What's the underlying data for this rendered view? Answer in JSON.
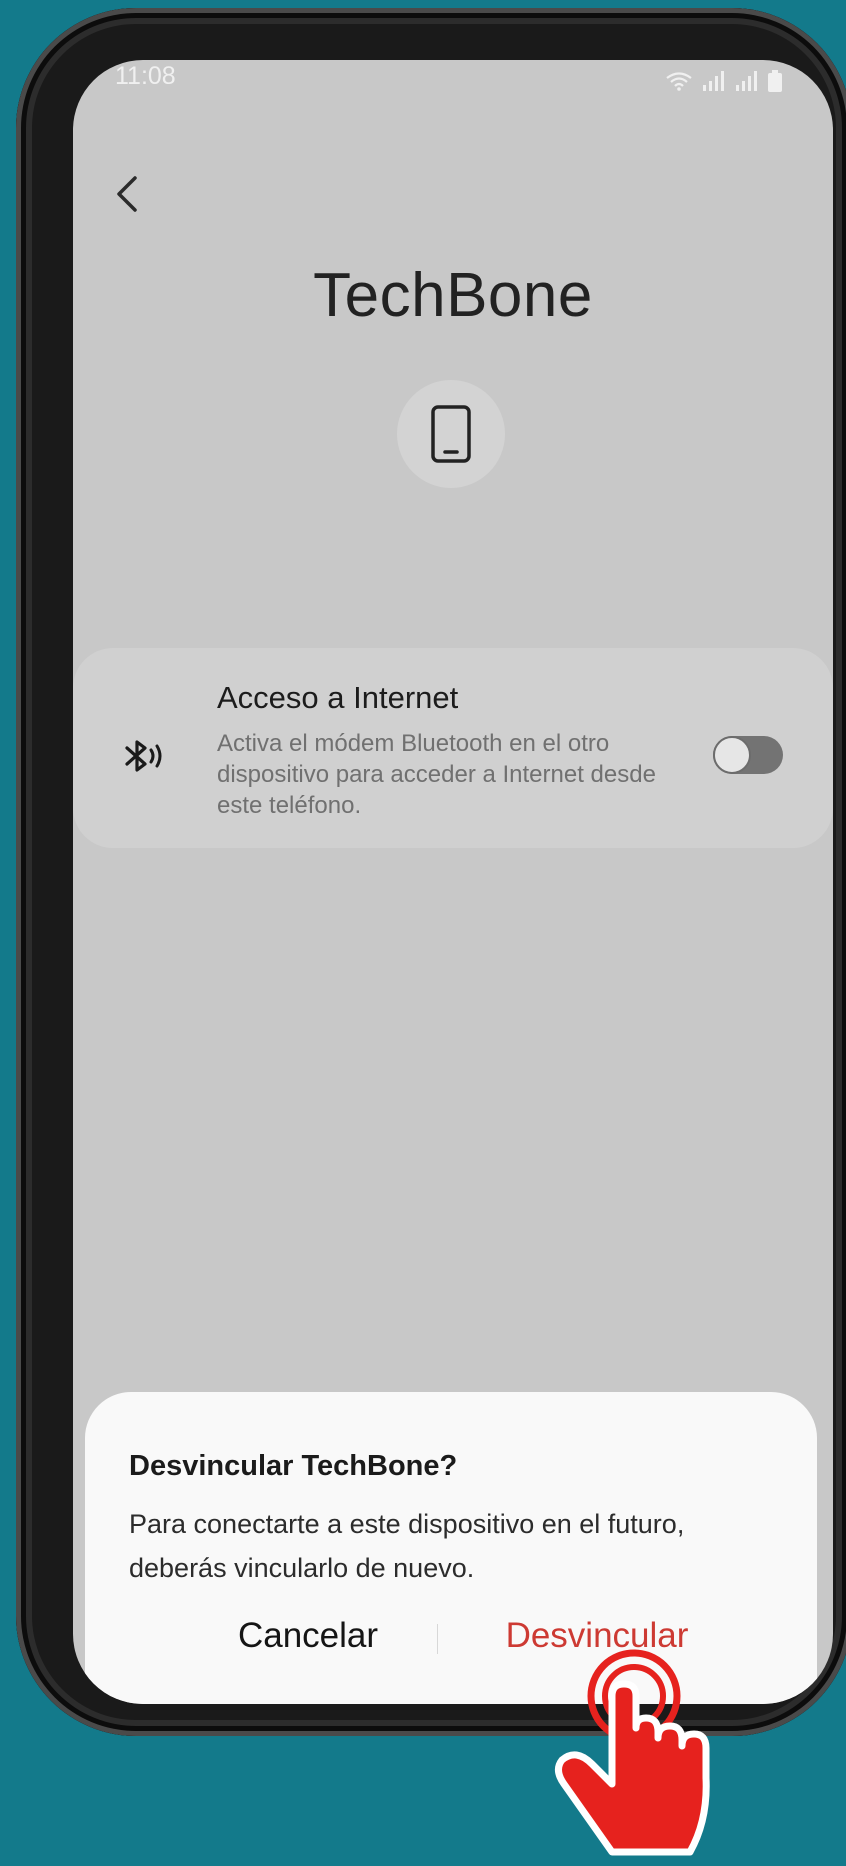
{
  "status_bar": {
    "time": "11:08"
  },
  "header": {
    "back_icon": "chevron-left-icon",
    "title": "TechBone",
    "device_icon": "smartphone-icon"
  },
  "internet_access": {
    "icon": "bluetooth-tethering-icon",
    "title": "Acceso a Internet",
    "description": "Activa el módem Bluetooth en el otro dispositivo para acceder a Internet desde este teléfono.",
    "toggle_on": false
  },
  "dialog": {
    "title": "Desvincular TechBone?",
    "message": "Para conectarte a este dispositivo en el futuro, deberás vincularlo de nuevo.",
    "cancel_label": "Cancelar",
    "unpair_label": "Desvincular"
  },
  "colors": {
    "background": "#137a8b",
    "screen": "#c8c8c8",
    "destructive": "#cd3a33",
    "pointer": "#e6221e"
  }
}
